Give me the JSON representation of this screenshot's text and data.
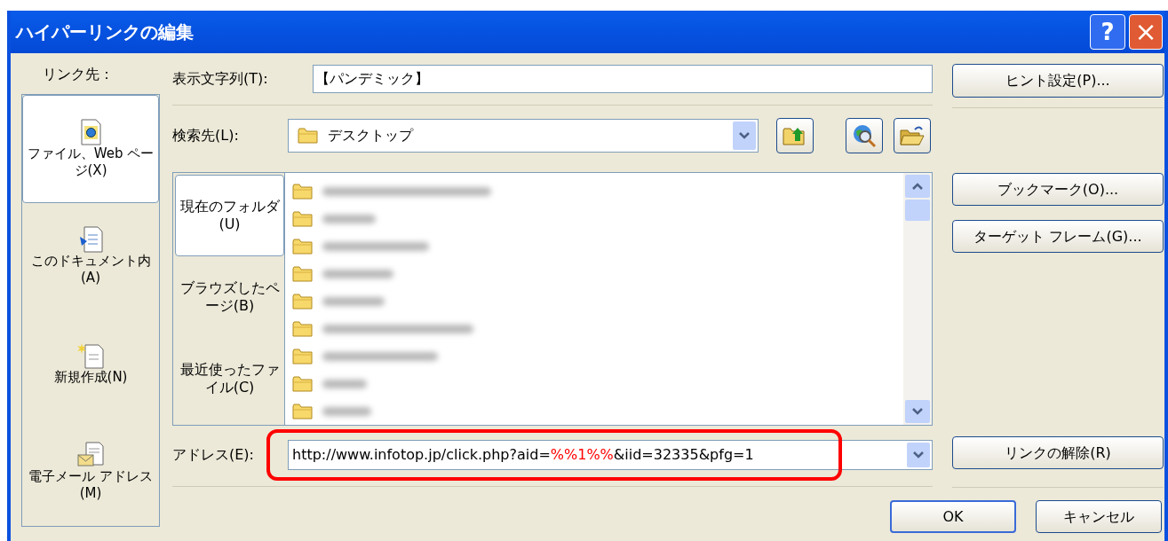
{
  "window": {
    "title": "ハイパーリンクの編集",
    "help_button": "?",
    "close_button": "×"
  },
  "link_to": {
    "label": "リンク先：",
    "items": [
      {
        "label": "ファイル、Web ページ(X)",
        "kind": "web",
        "selected": true
      },
      {
        "label": "このドキュメント内(A)",
        "kind": "document",
        "selected": false
      },
      {
        "label": "新規作成(N)",
        "kind": "new",
        "selected": false
      },
      {
        "label": "電子メール アドレス(M)",
        "kind": "email",
        "selected": false
      }
    ]
  },
  "display_text": {
    "label": "表示文字列(T):",
    "value": "【パンデミック】"
  },
  "hint_button": "ヒント設定(P)...",
  "look_in": {
    "label": "検索先(L):",
    "value": "デスクトップ"
  },
  "browse_tabs": [
    {
      "label": "現在のフォルダ(U)",
      "selected": true
    },
    {
      "label": "ブラウズしたページ(B)",
      "selected": false
    },
    {
      "label": "最近使ったファイル(C)",
      "selected": false
    }
  ],
  "files": [
    {
      "kind": "folder",
      "redacted": true
    },
    {
      "kind": "folder",
      "redacted": true
    },
    {
      "kind": "folder",
      "redacted": true
    },
    {
      "kind": "folder",
      "redacted": true
    },
    {
      "kind": "folder",
      "redacted": true
    },
    {
      "kind": "folder",
      "redacted": true
    },
    {
      "kind": "folder",
      "redacted": true
    },
    {
      "kind": "folder",
      "redacted": true
    },
    {
      "kind": "folder",
      "redacted": true
    }
  ],
  "side_buttons": [
    "ブックマーク(O)...",
    "ターゲット フレーム(G)..."
  ],
  "address": {
    "label": "アドレス(E):",
    "parts": [
      {
        "text": "http://www.infotop.jp/click.php?aid=",
        "highlight": false
      },
      {
        "text": "%%1%%",
        "highlight": true
      },
      {
        "text": "&iid=32335&pfg=1",
        "highlight": false
      }
    ],
    "annotated": true
  },
  "unlink_button": "リンクの解除(R)",
  "ok_button": "OK",
  "cancel_button": "キャンセル"
}
